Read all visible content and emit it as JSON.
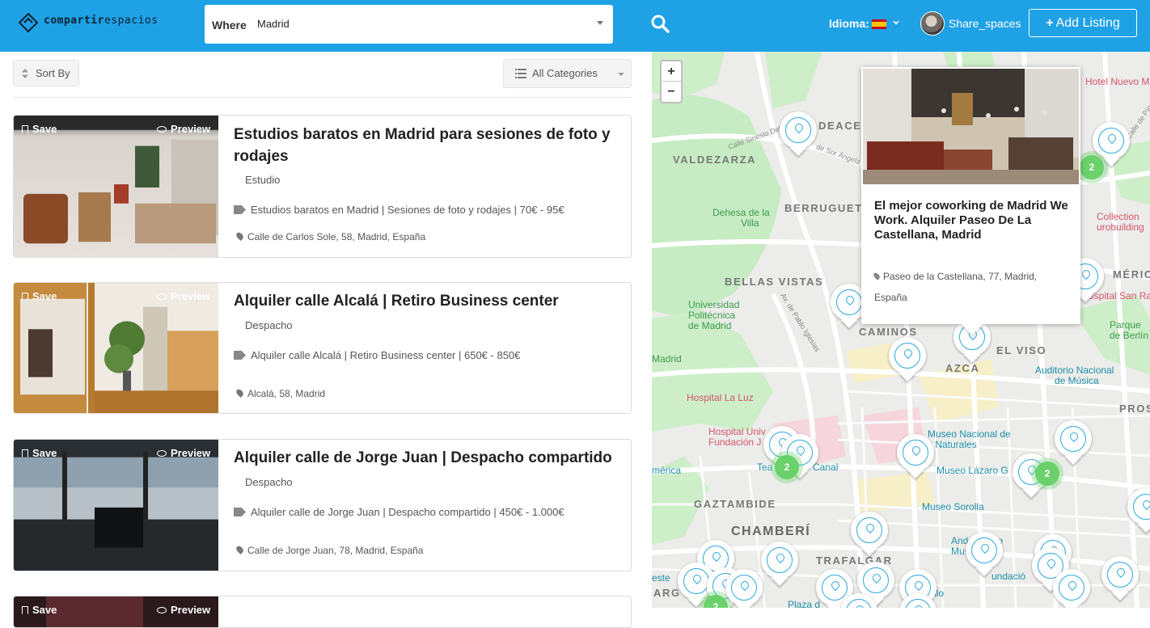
{
  "header": {
    "brand_a": "compartir",
    "brand_b": "espacios",
    "where_label": "Where",
    "where_value": "Madrid",
    "lang_label": "Idioma:",
    "username": "Share_spaces",
    "add_listing_plus": "+",
    "add_listing": "Add Listing"
  },
  "toolbar": {
    "sort_by": "Sort By",
    "categories": "All Categories"
  },
  "listings": [
    {
      "save": "Save",
      "preview": "Preview",
      "title": "Estudios baratos en Madrid para sesiones de foto y rodajes",
      "category": "Estudio",
      "tags": "Estudios baratos en Madrid | Sesiones de foto y rodajes | 70€ - 95€",
      "address": "Calle de Carlos Sole, 58, Madrid, España"
    },
    {
      "save": "Save",
      "preview": "Preview",
      "title": "Alquiler calle Alcalá | Retiro Business center",
      "category": "Despacho",
      "tags": "Alquiler calle Alcalá | Retiro Business center | 650€ - 850€",
      "address": "Alcalá, 58, Madrid"
    },
    {
      "save": "Save",
      "preview": "Preview",
      "title": "Alquiler calle de Jorge Juan | Despacho compartido",
      "category": "Despacho",
      "tags": "Alquiler calle de Jorge Juan | Despacho compartido | 450€ - 1.000€",
      "address": "Calle de Jorge Juan, 78, Madrid, España"
    },
    {
      "save": "Save",
      "preview": "Preview"
    }
  ],
  "map": {
    "zoom_in": "+",
    "zoom_out": "−",
    "labels": {
      "valdezarza": "VALDEZARZA",
      "berruguete": "BERRUGUET",
      "deacero": "DEACE",
      "bellas_vistas": "BELLAS VISTAS",
      "caminos": "CAMINOS",
      "azca": "AZCA",
      "el_viso": "EL VISO",
      "gaztambide": "GAZTAMBIDE",
      "chamberi": "CHAMBERÍ",
      "trafalgar": "TRAFALGAR",
      "america": "MÉRICA",
      "prospe": "PROSP",
      "dehesa_1": "Dehesa de la",
      "dehesa_2": "Villa",
      "upm_1": "Universidad",
      "upm_2": "Politécnica",
      "upm_3": "de Madrid",
      "madrid_left": "Madrid",
      "hospital_luz": "Hospital La Luz",
      "hospital_univ_1": "Hospital Univ",
      "hospital_univ_2": "Fundación J",
      "teatro": "Tea",
      "canal": "Canal",
      "america_left": "mérica",
      "museo_nat_1": "Museo Nacional de",
      "museo_nat_2": "s Naturales",
      "museo_lazaro": "Museo Lázaro G",
      "museo_sorolla": "Museo Sorolla",
      "anden_1": "Andén Cero",
      "anden_2": "Museo",
      "fundacio": "undació",
      "este": "este",
      "arg": "ARG",
      "plaza": "Plaza d",
      "ilo": "ilo",
      "auditorio_1": "Auditorio Nacional",
      "auditorio_2": "de Música",
      "parque_1": "Parque",
      "parque_2": "de Berlín",
      "hotel": "Hotel Nuevo M",
      "hospital_san_ra": "ospital San Ra",
      "collection_1": "Collection",
      "collection_2": "urobuilding",
      "calle_sinesio": "Calle Sinesio Delgado",
      "calle_san_angela": "de Sor Ángela",
      "av_pablo": "Av. de Pablo Iglesias",
      "calle_pio": "Calle de Pío"
    },
    "clusters": [
      "2",
      "2",
      "2",
      "2"
    ]
  },
  "popup": {
    "title": "El mejor coworking de Madrid We Work. Alquiler Paseo De La Castellana, Madrid",
    "address": "Paseo de la Castellana, 77, Madrid, España"
  },
  "colors": {
    "header_bg": "#1fa1e6",
    "cluster_green": "#6bd16b",
    "marker_blue": "#2aa7de"
  }
}
